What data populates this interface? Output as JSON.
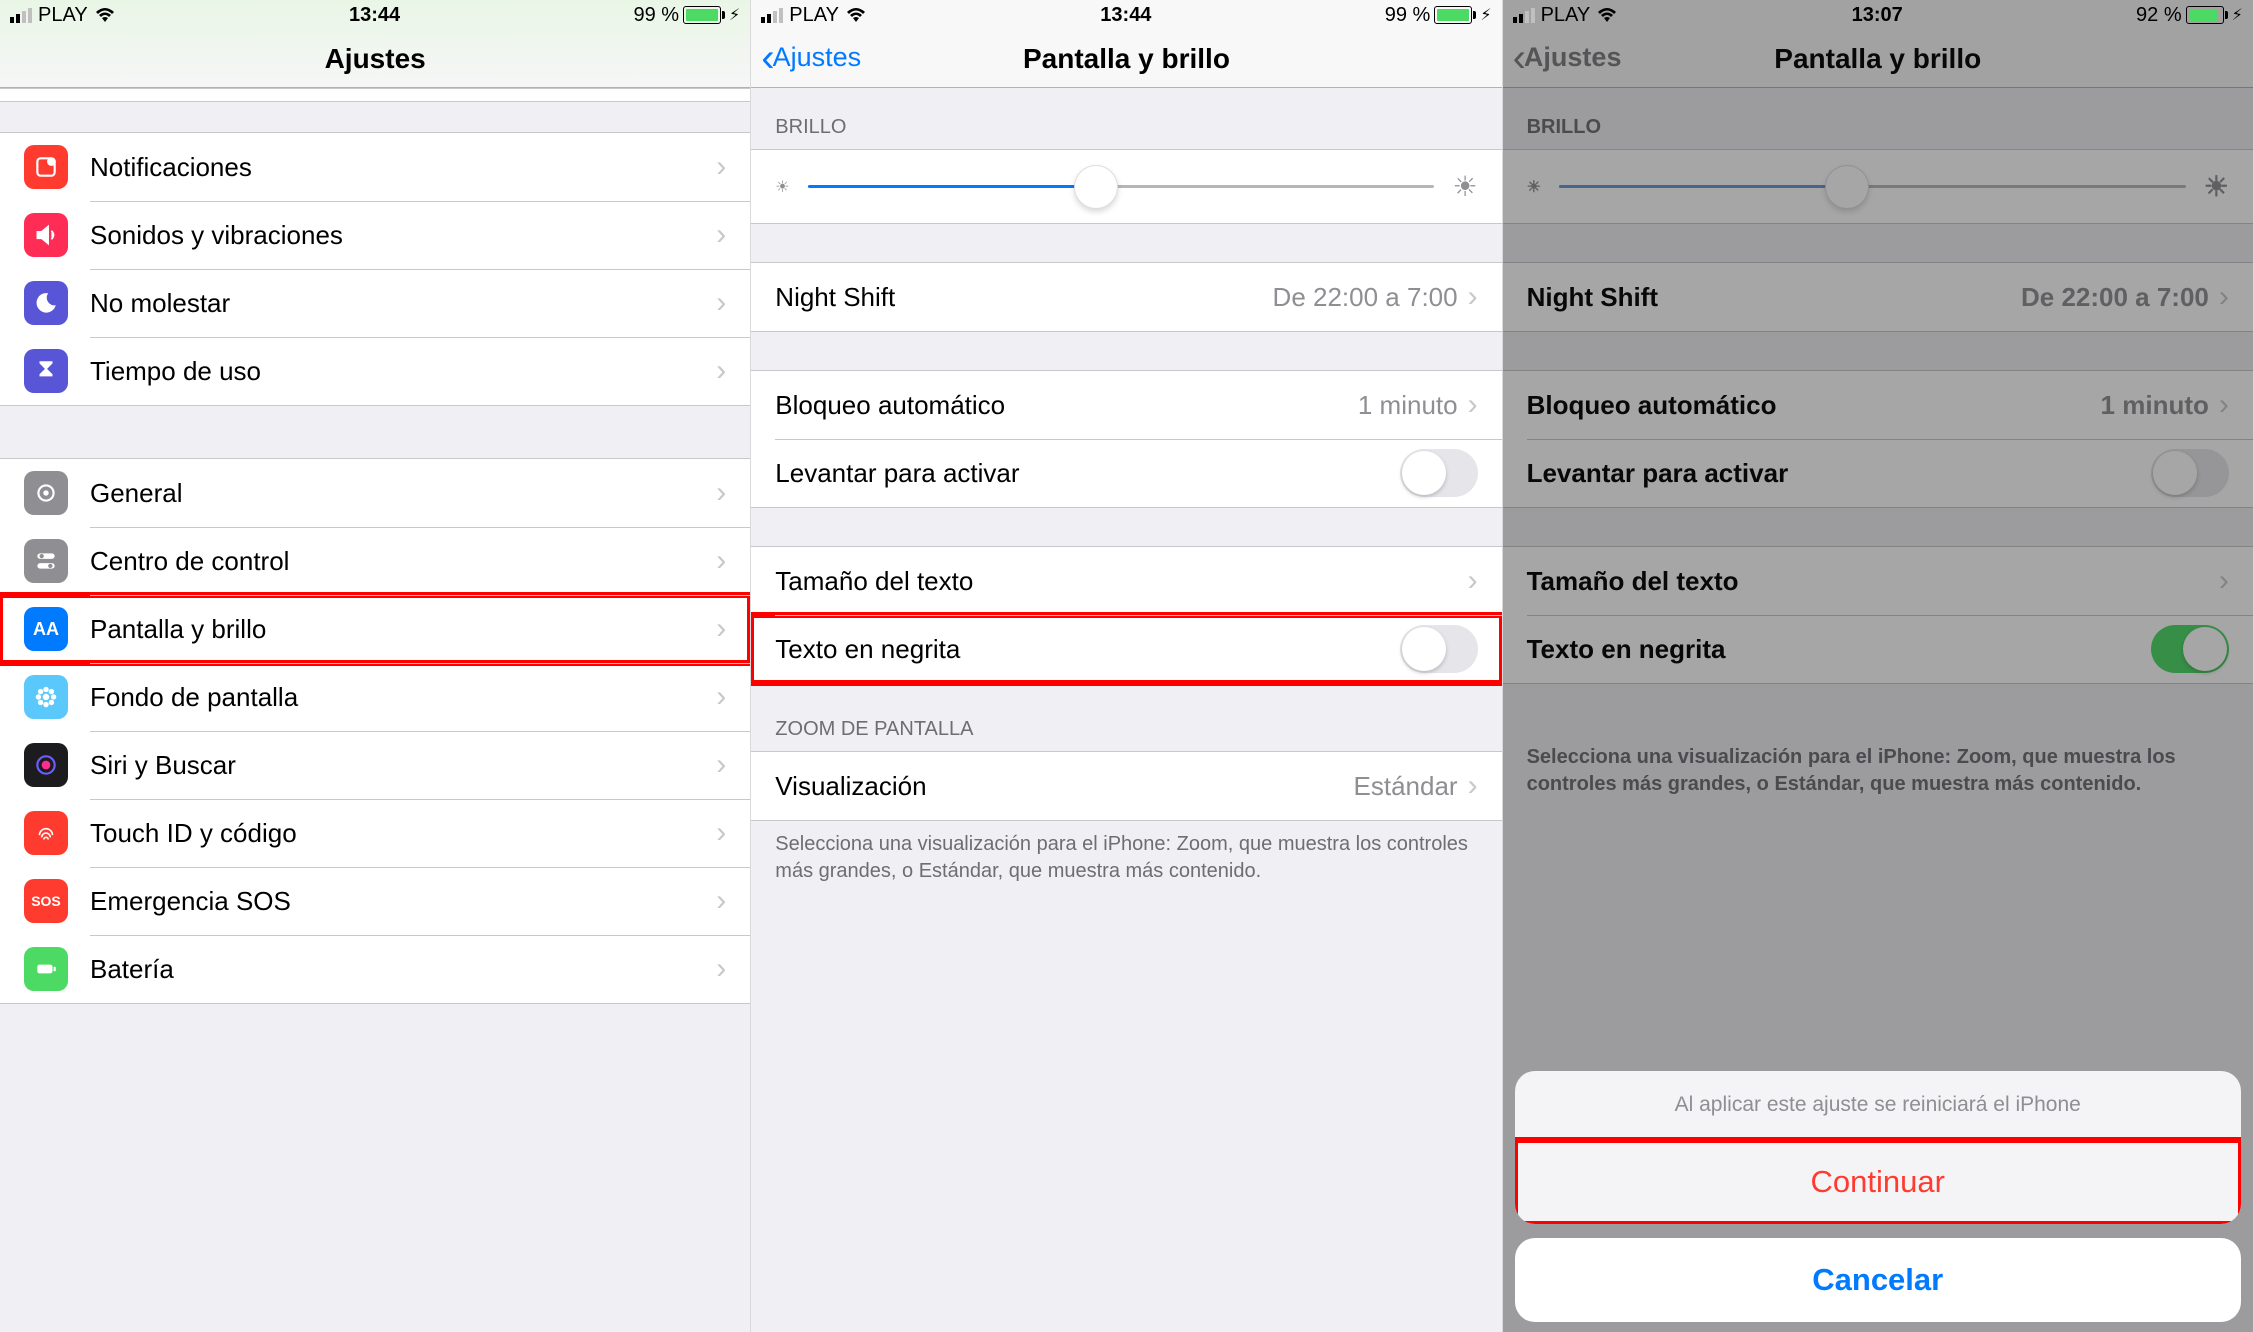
{
  "status1": {
    "carrier": "PLAY",
    "time": "13:44",
    "battery_pct": "99 %"
  },
  "status2": {
    "carrier": "PLAY",
    "time": "13:44",
    "battery_pct": "99 %"
  },
  "status3": {
    "carrier": "PLAY",
    "time": "13:07",
    "battery_pct": "92 %"
  },
  "panel1": {
    "title": "Ajustes",
    "g1": [
      {
        "label": "Notificaciones"
      },
      {
        "label": "Sonidos y vibraciones"
      },
      {
        "label": "No molestar"
      },
      {
        "label": "Tiempo de uso"
      }
    ],
    "g2": [
      {
        "label": "General"
      },
      {
        "label": "Centro de control"
      },
      {
        "label": "Pantalla y brillo"
      },
      {
        "label": "Fondo de pantalla"
      },
      {
        "label": "Siri y Buscar"
      },
      {
        "label": "Touch ID y código"
      },
      {
        "label": "Emergencia SOS"
      },
      {
        "label": "Batería"
      }
    ]
  },
  "panel2": {
    "back": "Ajustes",
    "title": "Pantalla y brillo",
    "brillo_header": "BRILLO",
    "night_shift": "Night Shift",
    "night_shift_val": "De 22:00 a 7:00",
    "auto_lock": "Bloqueo automático",
    "auto_lock_val": "1 minuto",
    "raise": "Levantar para activar",
    "text_size": "Tamaño del texto",
    "bold": "Texto en negrita",
    "zoom_header": "ZOOM DE PANTALLA",
    "view": "Visualización",
    "view_val": "Estándar",
    "footer": "Selecciona una visualización para el iPhone: Zoom, que muestra los controles más grandes, o Estándar, que muestra más contenido."
  },
  "panel3": {
    "back": "Ajustes",
    "title": "Pantalla y brillo",
    "brillo_header": "BRILLO",
    "night_shift": "Night Shift",
    "night_shift_val": "De 22:00 a 7:00",
    "auto_lock": "Bloqueo automático",
    "auto_lock_val": "1 minuto",
    "raise": "Levantar para activar",
    "text_size": "Tamaño del texto",
    "bold": "Texto en negrita",
    "sheet_msg": "Al aplicar este ajuste se reiniciará el iPhone",
    "sheet_continue": "Continuar",
    "sheet_cancel": "Cancelar",
    "footer": "Selecciona una visualización para el iPhone: Zoom, que muestra los controles más grandes, o Estándar, que muestra más contenido."
  }
}
